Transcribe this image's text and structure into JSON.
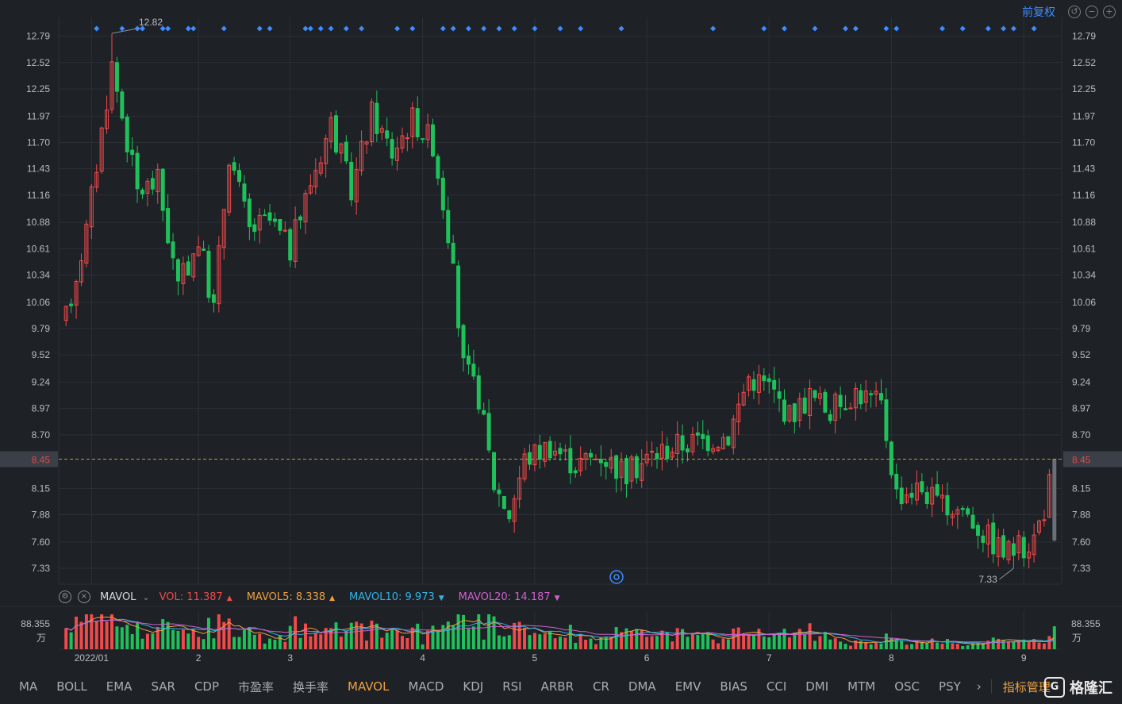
{
  "toolbar": {
    "adjust_label": "前复权",
    "icons": [
      "undo-icon",
      "zoom-out-icon",
      "zoom-in-icon"
    ]
  },
  "colors": {
    "up": "#f04a4a",
    "down": "#1fc25a",
    "bg": "#1e2126",
    "grid": "#2c3037",
    "axis_text": "#b8bcc3",
    "ref_line": "#c9963c",
    "ref_label_bg": "#e04a4a",
    "marker": "#3f8cff",
    "mavol5": "#f0a040",
    "mavol10": "#30b4e8",
    "mavol20": "#d060d0"
  },
  "legend": {
    "gear_icon": "gear-icon",
    "close_icon": "close-icon",
    "indicator_name": "MAVOL",
    "items": [
      {
        "label": "VOL: 11.387",
        "color": "#f04a4a",
        "arrow": "▲"
      },
      {
        "label": "MAVOL5: 8.338",
        "color": "#f0a040",
        "arrow": "▲"
      },
      {
        "label": "MAVOL10: 9.973",
        "color": "#30b4e8",
        "arrow": "▼"
      },
      {
        "label": "MAVOL20: 14.187",
        "color": "#d060d0",
        "arrow": "▼"
      }
    ]
  },
  "tabs": {
    "items": [
      "MA",
      "BOLL",
      "EMA",
      "SAR",
      "CDP",
      "市盈率",
      "换手率",
      "MAVOL",
      "MACD",
      "KDJ",
      "RSI",
      "ARBR",
      "CR",
      "DMA",
      "EMV",
      "BIAS",
      "CCI",
      "DMI",
      "MTM",
      "OSC",
      "PSY"
    ],
    "active": "MAVOL",
    "more": "›",
    "manager": "指标管理"
  },
  "logo": {
    "text": "格隆汇",
    "mark": "G"
  },
  "chart_data": {
    "type": "candlestick",
    "y_ticks": [
      "12.79",
      "12.52",
      "12.25",
      "11.97",
      "11.70",
      "11.43",
      "11.16",
      "10.88",
      "10.61",
      "10.34",
      "10.06",
      "9.79",
      "9.52",
      "9.24",
      "8.97",
      "8.70",
      "8.15",
      "7.88",
      "7.60",
      "7.33"
    ],
    "ylim": [
      7.2,
      12.95
    ],
    "x_ticks": [
      {
        "label": "2022/01",
        "index": 5
      },
      {
        "label": "2",
        "index": 26
      },
      {
        "label": "3",
        "index": 44
      },
      {
        "label": "4",
        "index": 70
      },
      {
        "label": "5",
        "index": 92
      },
      {
        "label": "6",
        "index": 114
      },
      {
        "label": "7",
        "index": 138
      },
      {
        "label": "8",
        "index": 162
      },
      {
        "label": "9",
        "index": 188
      }
    ],
    "reference": {
      "value": 8.45,
      "label": "8.45"
    },
    "annotations": [
      {
        "label": "12.82",
        "value": 12.82,
        "index": 9
      },
      {
        "label": "7.33",
        "value": 7.33,
        "index": 186
      }
    ],
    "volume": {
      "axis_label": "88.355",
      "unit": "万",
      "max": 88.355
    },
    "center_icon": "at-icon",
    "event_marker_indexes": [
      6,
      11,
      14,
      15,
      19,
      20,
      24,
      25,
      31,
      38,
      40,
      47,
      48,
      50,
      52,
      55,
      58,
      65,
      68,
      74,
      76,
      79,
      82,
      85,
      88,
      92,
      97,
      101,
      109,
      127,
      137,
      141,
      147,
      153,
      155,
      161,
      163,
      172,
      176,
      181,
      184,
      186,
      190
    ]
  }
}
